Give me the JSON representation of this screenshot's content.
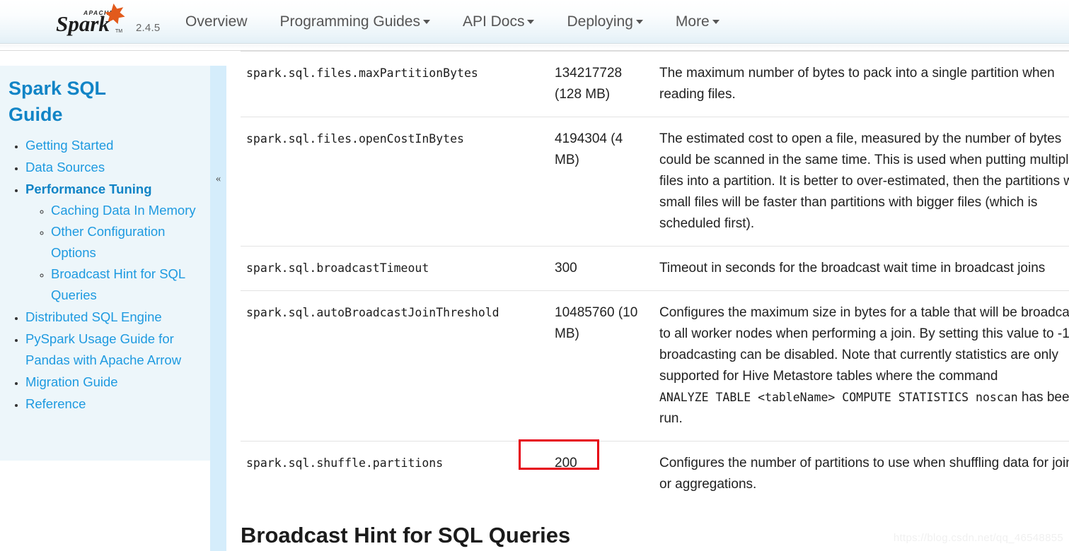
{
  "navbar": {
    "brand_name": "Apache Spark",
    "version": "2.4.5",
    "links": [
      {
        "label": "Overview",
        "caret": false
      },
      {
        "label": "Programming Guides",
        "caret": true
      },
      {
        "label": "API Docs",
        "caret": true
      },
      {
        "label": "Deploying",
        "caret": true
      },
      {
        "label": "More",
        "caret": true
      }
    ]
  },
  "sidebar": {
    "title": "Spark SQL Guide",
    "collapse_glyph": "«",
    "items": [
      {
        "label": "Getting Started",
        "current": false,
        "children": []
      },
      {
        "label": "Data Sources",
        "current": false,
        "children": []
      },
      {
        "label": "Performance Tuning",
        "current": true,
        "children": [
          {
            "label": "Caching Data In Memory"
          },
          {
            "label": "Other Configuration Options"
          },
          {
            "label": "Broadcast Hint for SQL Queries"
          }
        ]
      },
      {
        "label": "Distributed SQL Engine",
        "current": false,
        "children": []
      },
      {
        "label": "PySpark Usage Guide for Pandas with Apache Arrow",
        "current": false,
        "children": []
      },
      {
        "label": "Migration Guide",
        "current": false,
        "children": []
      },
      {
        "label": "Reference",
        "current": false,
        "children": []
      }
    ]
  },
  "table": {
    "rows": [
      {
        "property": "spark.sql.files.maxPartitionBytes",
        "default": "134217728 (128 MB)",
        "meaning": "The maximum number of bytes to pack into a single partition when reading files."
      },
      {
        "property": "spark.sql.files.openCostInBytes",
        "default": "4194304 (4 MB)",
        "meaning": "The estimated cost to open a file, measured by the number of bytes could be scanned in the same time. This is used when putting multiple files into a partition. It is better to over-estimated, then the partitions with small files will be faster than partitions with bigger files (which is scheduled first)."
      },
      {
        "property": "spark.sql.broadcastTimeout",
        "default": "300",
        "meaning": "Timeout in seconds for the broadcast wait time in broadcast joins"
      },
      {
        "property": "spark.sql.autoBroadcastJoinThreshold",
        "default": "10485760 (10 MB)",
        "meaning_part1": "Configures the maximum size in bytes for a table that will be broadcast to all worker nodes when performing a join. By setting this value to -1 broadcasting can be disabled. Note that currently statistics are only supported for Hive Metastore tables where the command ",
        "meaning_code": "ANALYZE TABLE <tableName> COMPUTE STATISTICS noscan",
        "meaning_part2": " has been run."
      },
      {
        "property": "spark.sql.shuffle.partitions",
        "default": "200",
        "meaning": "Configures the number of partitions to use when shuffling data for joins or aggregations."
      }
    ]
  },
  "section_heading": "Broadcast Hint for SQL Queries",
  "annotation": {
    "target_value": "200",
    "color": "#e60012"
  },
  "watermark": "https://blog.csdn.net/qq_46548855"
}
